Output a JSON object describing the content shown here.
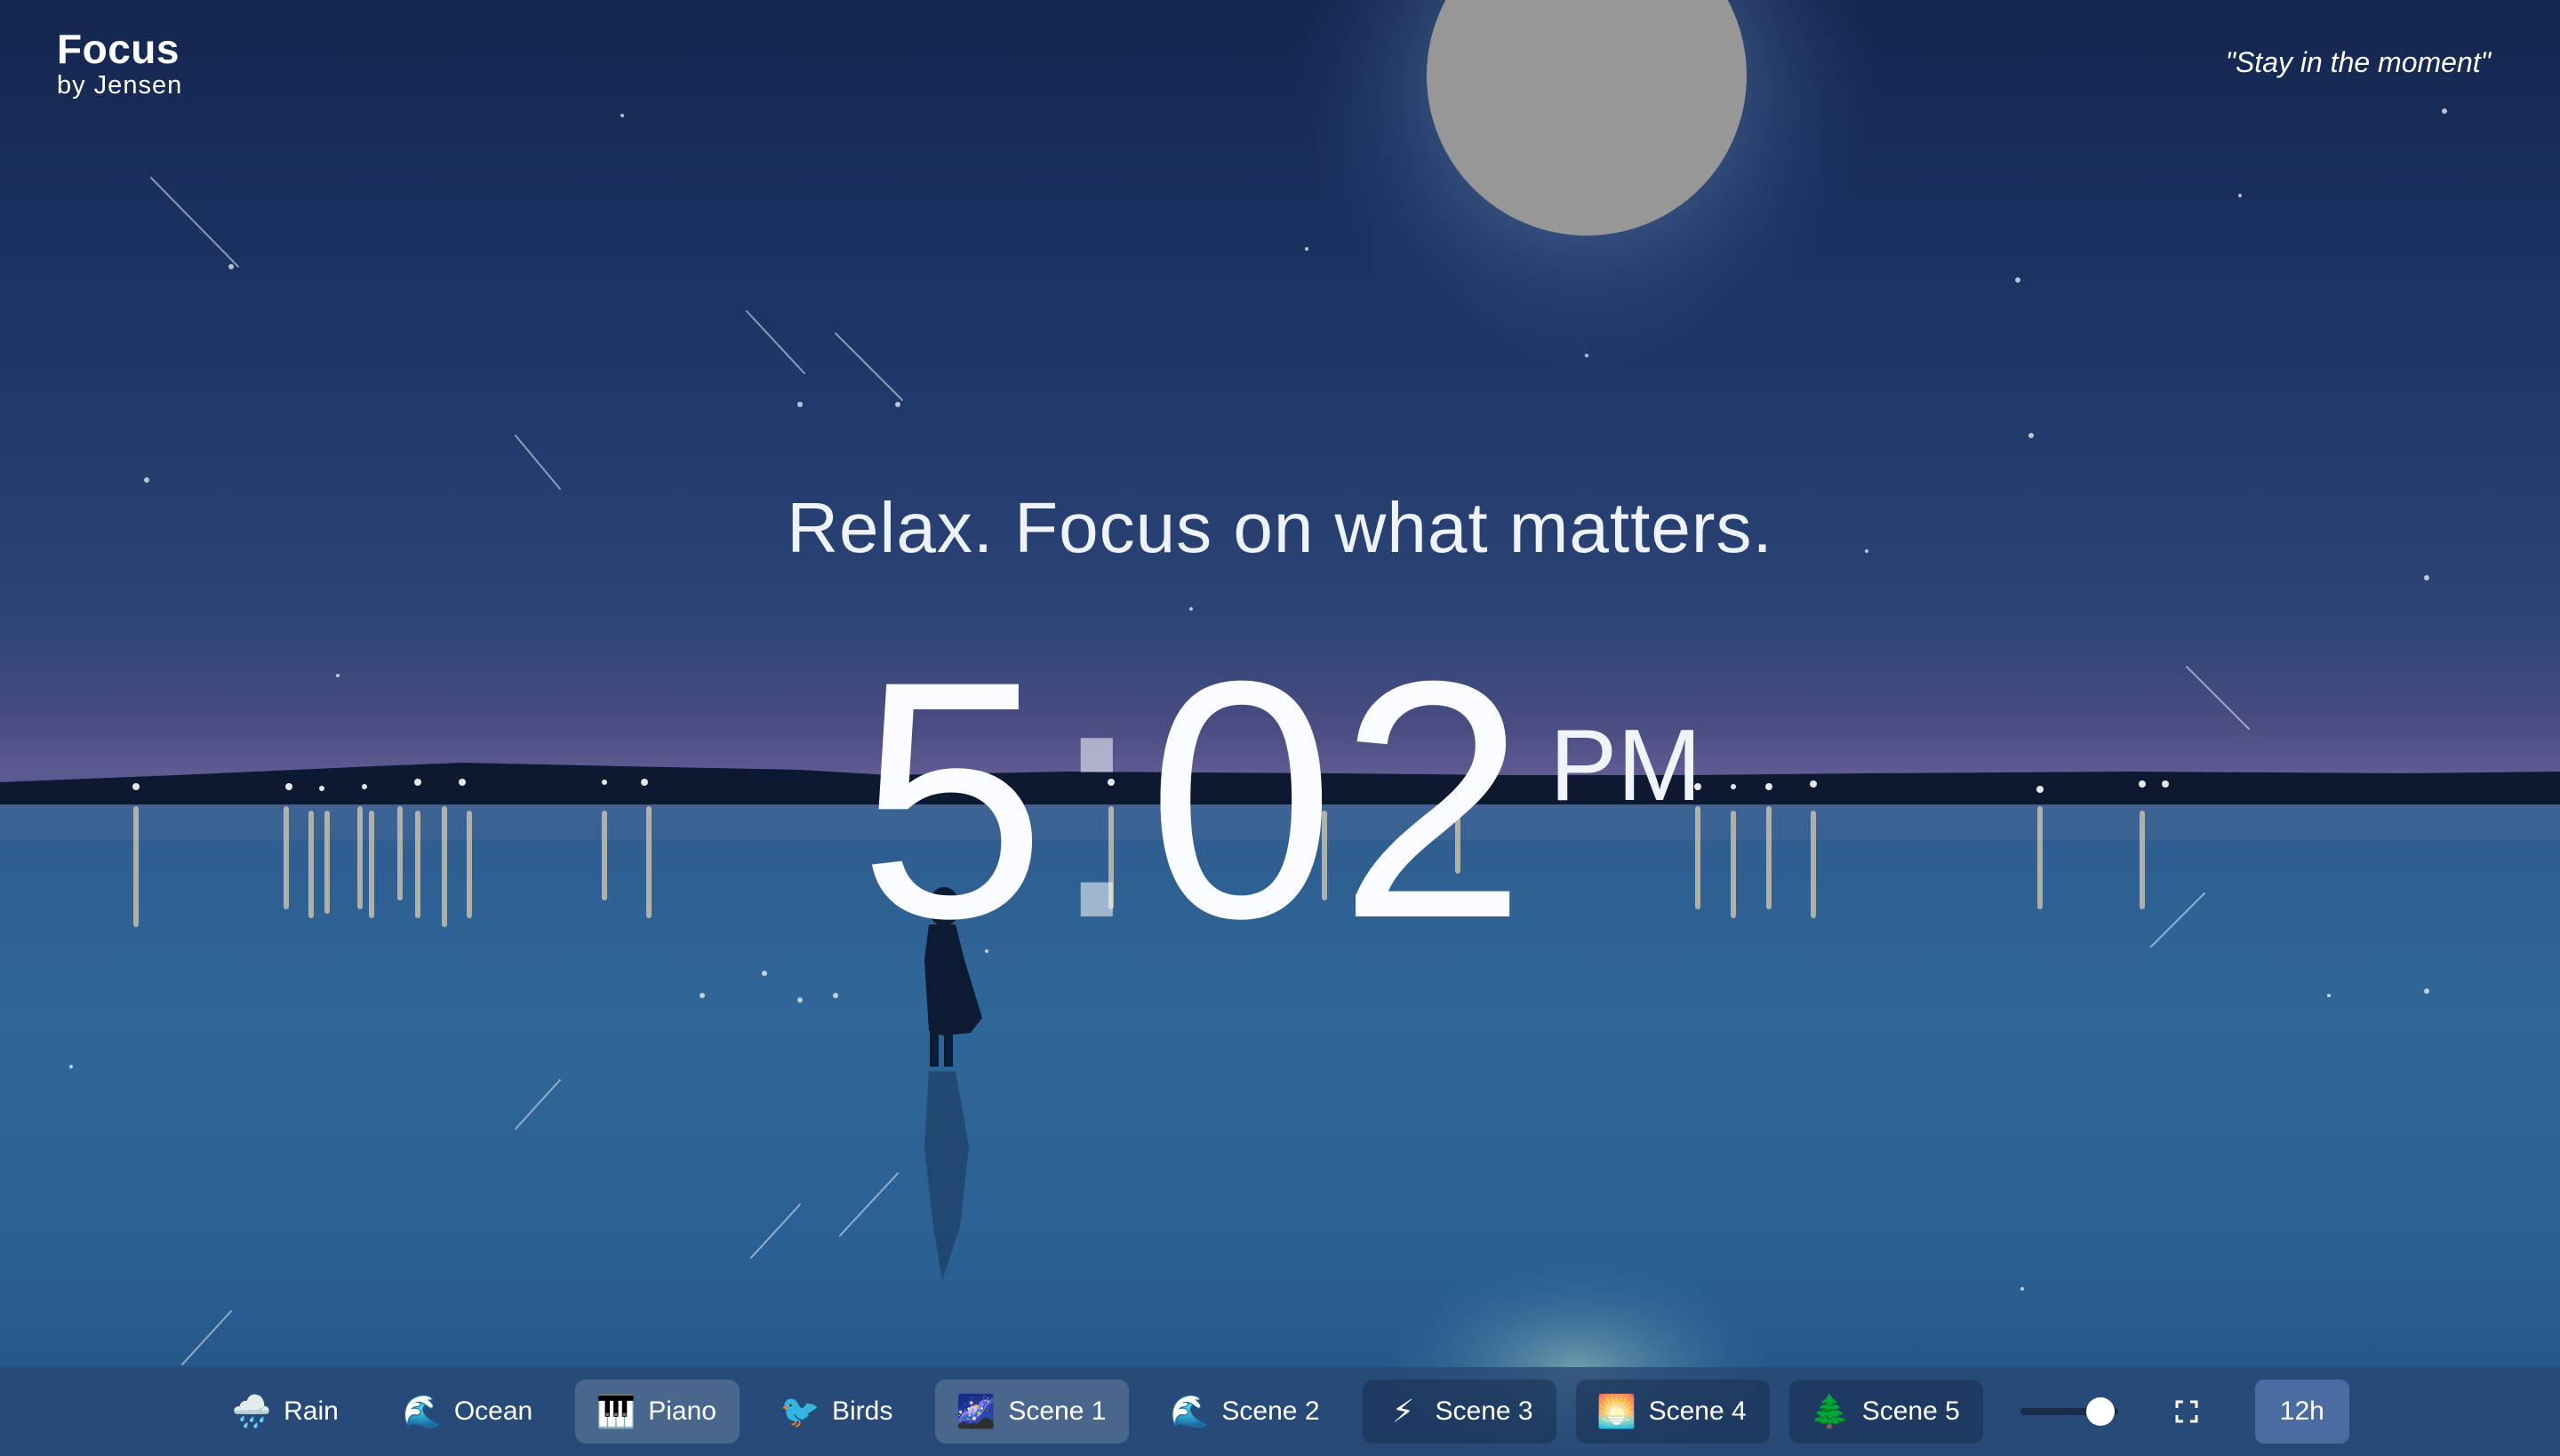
{
  "brand": {
    "title": "Focus",
    "subtitle": "by Jensen"
  },
  "quote": "\"Stay in the moment\"",
  "tagline": "Relax. Focus on what matters.",
  "clock": {
    "hour": "5",
    "colon": ":",
    "minute": "02",
    "ampm": "PM"
  },
  "controls": {
    "items": [
      {
        "label": "Rain",
        "icon": "rain-cloud-icon",
        "glyph": "🌧️",
        "state": "normal"
      },
      {
        "label": "Ocean",
        "icon": "wave-icon",
        "glyph": "🌊",
        "state": "normal"
      },
      {
        "label": "Piano",
        "icon": "piano-icon",
        "glyph": "🎹",
        "state": "active"
      },
      {
        "label": "Birds",
        "icon": "bird-icon",
        "glyph": "🐦",
        "state": "normal"
      },
      {
        "label": "Scene 1",
        "icon": "night-sky-icon",
        "glyph": "🌌",
        "state": "active"
      },
      {
        "label": "Scene 2",
        "icon": "wave-icon",
        "glyph": "🌊",
        "state": "normal"
      },
      {
        "label": "Scene 3",
        "icon": "lightning-icon",
        "glyph": "⚡",
        "state": "dark"
      },
      {
        "label": "Scene 4",
        "icon": "sunset-icon",
        "glyph": "🌅",
        "state": "dark"
      },
      {
        "label": "Scene 5",
        "icon": "pine-tree-icon",
        "glyph": "🌲",
        "state": "dark"
      }
    ],
    "volume": 0.82,
    "format_label": "12h"
  }
}
